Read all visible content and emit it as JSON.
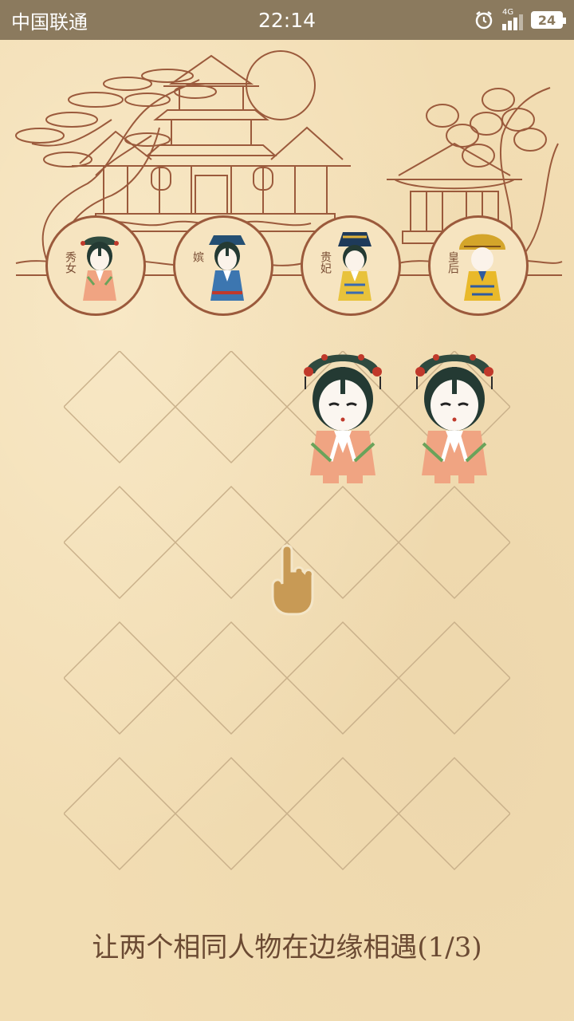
{
  "status_bar": {
    "carrier": "中国联通",
    "time": "22:14",
    "network": "4G",
    "battery": "24"
  },
  "ranks": [
    {
      "label": "秀女",
      "costume": "peach"
    },
    {
      "label": "嫔",
      "costume": "blue"
    },
    {
      "label": "贵妃",
      "costume": "gold"
    },
    {
      "label": "皇后",
      "costume": "yellow"
    }
  ],
  "board": {
    "rows": 4,
    "cols": 4,
    "pieces": [
      {
        "row": 0,
        "col": 2,
        "rank": "秀女"
      },
      {
        "row": 0,
        "col": 3,
        "rank": "秀女"
      }
    ]
  },
  "hint_text": "让两个相同人物在边缘相遇(1/3)",
  "colors": {
    "background": "#f2ddb3",
    "line_art": "#9b5a3c",
    "grid": "#c9b08a",
    "status_bar": "#8b7a5e",
    "hand": "#c89a55"
  }
}
